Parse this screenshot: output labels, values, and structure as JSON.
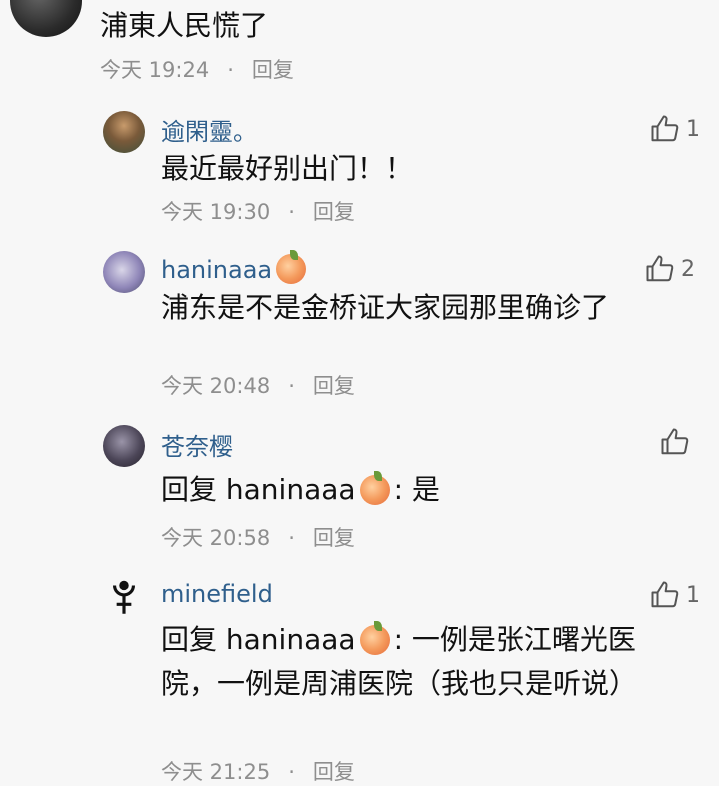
{
  "top_comment": {
    "text": "浦東人民慌了",
    "time": "今天 19:24",
    "dot": "·",
    "reply": "回复"
  },
  "replies": [
    {
      "name": "逾閑靈。",
      "text": "最近最好别出门！！",
      "time": "今天 19:30",
      "dot": "·",
      "reply": "回复",
      "likes": "1"
    },
    {
      "name": "haninaaa",
      "name_emoji": "peach-emoji",
      "text": "浦东是不是金桥证大家园那里确诊了",
      "time": "今天 20:48",
      "dot": "·",
      "reply": "回复",
      "likes": "2"
    },
    {
      "name": "苍奈樱",
      "reply_prefix": "回复 haninaaa",
      "text": ": 是",
      "time": "今天 20:58",
      "dot": "·",
      "reply": "回复",
      "likes": ""
    },
    {
      "name": "minefield",
      "avatar_icon": "pluto-symbol-icon",
      "reply_prefix": "回复 haninaaa",
      "text": ": 一例是张江曙光医院，一例是周浦医院（我也只是听说）",
      "time": "今天 21:25",
      "dot": "·",
      "reply": "回复",
      "likes": "1"
    }
  ],
  "colors": {
    "username": "#2f5f8c",
    "meta": "#8e8e8e",
    "text": "#111111",
    "background": "#f7f7f7"
  }
}
